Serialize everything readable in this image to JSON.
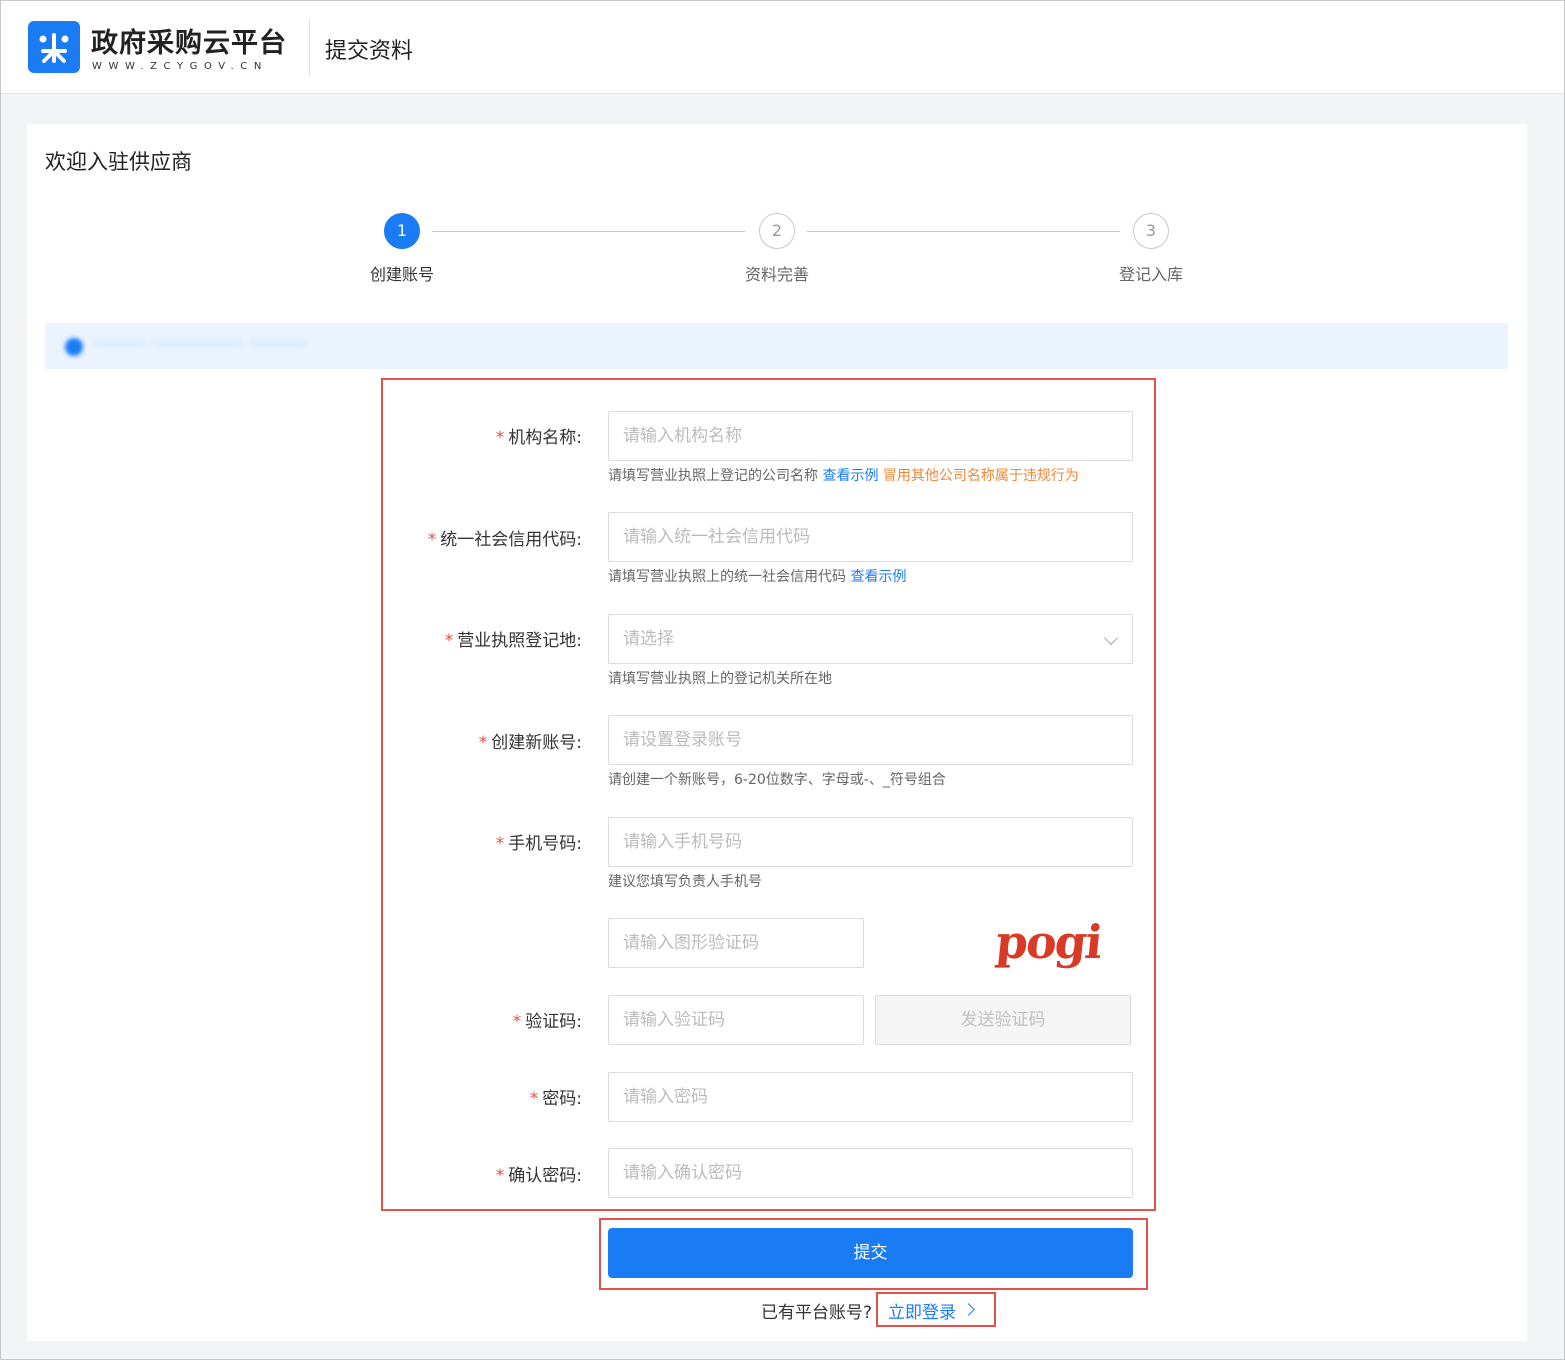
{
  "header": {
    "brand_name": "政府采购云平台",
    "brand_url": "WWW.ZCYGOV.CN",
    "page_title": "提交资料"
  },
  "welcome": "欢迎入驻供应商",
  "steps": [
    {
      "num": "1",
      "label": "创建账号",
      "active": true
    },
    {
      "num": "2",
      "label": "资料完善",
      "active": false
    },
    {
      "num": "3",
      "label": "登记入库",
      "active": false
    }
  ],
  "notice": {
    "text": "········ ·············· ·········"
  },
  "form": {
    "org_name": {
      "label": "机构名称:",
      "placeholder": "请输入机构名称",
      "hint": "请填写营业执照上登记的公司名称",
      "hint_link": "查看示例",
      "hint_warn": "冒用其他公司名称属于违规行为"
    },
    "credit_code": {
      "label": "统一社会信用代码:",
      "placeholder": "请输入统一社会信用代码",
      "hint": "请填写营业执照上的统一社会信用代码",
      "hint_link": "查看示例"
    },
    "license_place": {
      "label": "营业执照登记地:",
      "placeholder": "请选择",
      "hint": "请填写营业执照上的登记机关所在地"
    },
    "account": {
      "label": "创建新账号:",
      "placeholder": "请设置登录账号",
      "hint": "请创建一个新账号，6-20位数字、字母或-、_符号组合"
    },
    "phone": {
      "label": "手机号码:",
      "placeholder": "请输入手机号码",
      "hint": "建议您填写负责人手机号"
    },
    "captcha": {
      "placeholder": "请输入图形验证码",
      "image_text": "pogi"
    },
    "verify_code": {
      "label": "验证码:",
      "placeholder": "请输入验证码",
      "send_label": "发送验证码"
    },
    "password": {
      "label": "密码:",
      "placeholder": "请输入密码"
    },
    "confirm_password": {
      "label": "确认密码:",
      "placeholder": "请输入确认密码"
    },
    "required_mark": "*"
  },
  "submit_label": "提交",
  "login": {
    "text": "已有平台账号?",
    "link": "立即登录"
  },
  "colors": {
    "accent": "#1a7cf5",
    "required": "#e4504a",
    "warn": "#f0883a"
  }
}
